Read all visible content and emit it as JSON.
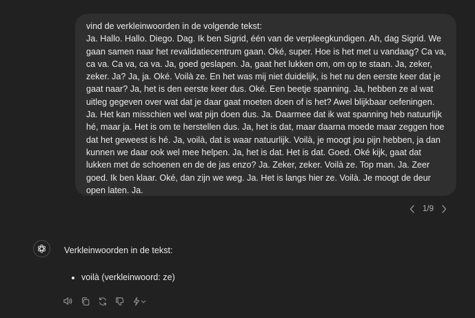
{
  "user_message": {
    "text": "vind de verkleinwoorden in de volgende tekst:\nJa. Hallo. Hallo. Diego. Dag. Ik ben Sigrid, één van de verpleegkundigen. Ah, dag Sigrid. We gaan samen naar het revalidatiecentrum gaan. Oké, super. Hoe is het met u vandaag? Ca va, ca va. Ca va, ca va. Ja, goed geslapen. Ja, gaat het lukken om, om op te staan. Ja, zeker, zeker. Ja?  Ja, ja. Oké. Voilà ze. En het was mij niet duidelijk, is het nu den eerste keer dat je gaat naar? Ja, het is den eerste keer dus. Oké. Een beetje spanning. Ja, hebben ze al wat uitleg gegeven over wat dat je daar gaat moeten doen of is het? Awel blijkbaar oefeningen. Ja. Het kan misschien wel wat pijn doen dus. Ja. Daarmee dat ik wat spanning heb natuurlijk hé, maar ja. Het is om te herstellen dus. Ja, het is dat, maar daarna moede maar zeggen hoe dat het geweest is hé. Ja, voilà, dat is waar natuurlijk. Voilà, je moogt jou pijn hebben, ja dan kunnen we daar ook wel mee helpen. Ja, het is dat. Het is dat. Goed. Oké kijk, gaat dat lukken met de schoenen en de de jas enzo? Ja. Zeker, zeker. Voilà ze. Top man. Ja. Zeer goed. Ik ben klaar. Oké, dan zijn we weg. Ja. Het is langs hier ze. Voilà. Je moogt de deur open laten. Ja."
  },
  "pager": {
    "label": "1/9"
  },
  "assistant": {
    "intro": "Verkleinwoorden in de tekst:",
    "items": [
      "voilà (verkleinwoord: ze)"
    ]
  },
  "icons": {
    "prev": "chevron-left-icon",
    "next": "chevron-right-icon",
    "avatar": "openai-logo-icon",
    "read_aloud": "speaker-icon",
    "copy": "copy-icon",
    "regenerate": "regenerate-icon",
    "dislike": "thumbs-down-icon",
    "model": "sparkle-switch-icon"
  },
  "colors": {
    "background": "#212121",
    "bubble": "#2f2f2f",
    "text": "#ececec",
    "muted": "#8e8e8e"
  }
}
